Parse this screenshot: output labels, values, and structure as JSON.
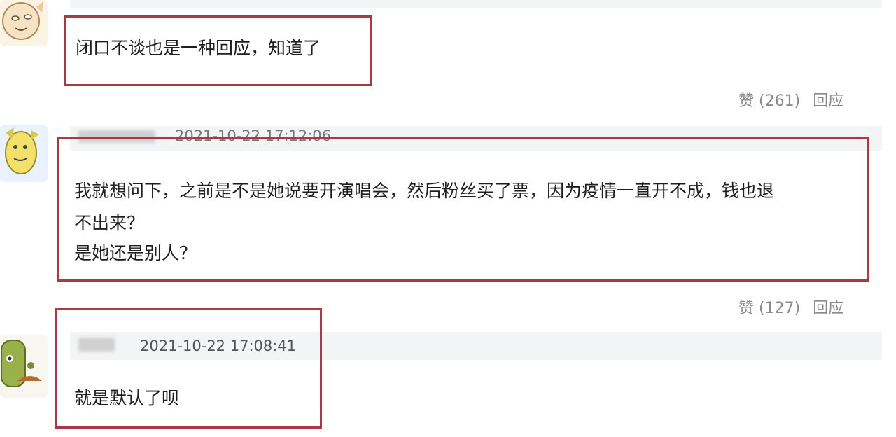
{
  "comments": [
    {
      "text_lines": [
        "闭口不谈也是一种回应，知道了"
      ],
      "like_label": "赞",
      "like_count": "(261)",
      "reply_label": "回应"
    },
    {
      "timestamp": "2021-10-22 17:12:06",
      "text_lines": [
        "我就想问下，之前是不是她说要开演唱会，然后粉丝买了票，因为疫情一直开不成，钱也退",
        "不出来？",
        "是她还是别人？"
      ],
      "like_label": "赞",
      "like_count": "(127)",
      "reply_label": "回应"
    },
    {
      "timestamp": "2021-10-22 17:08:41",
      "text_lines": [
        "就是默认了呗"
      ]
    }
  ],
  "colors": {
    "highlight_border": "#a83a45",
    "meta_background": "#f3f4f6",
    "action_text": "#8a8a8a"
  }
}
